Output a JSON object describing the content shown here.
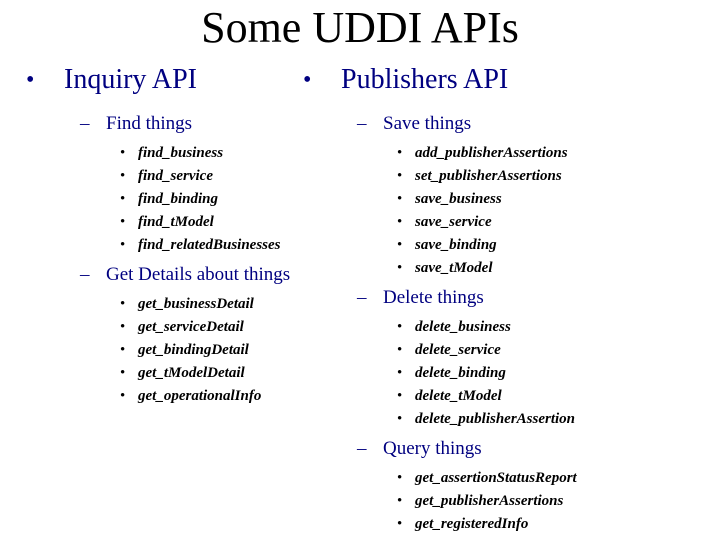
{
  "slide": {
    "title": "Some UDDI APIs",
    "bullet_glyph": "•",
    "dash_glyph": "–",
    "columns": [
      {
        "heading": "Inquiry API",
        "groups": [
          {
            "label": "Find things",
            "items": [
              "find_business",
              "find_service",
              "find_binding",
              "find_tModel",
              "find_relatedBusinesses"
            ]
          },
          {
            "label": "Get Details about things",
            "items": [
              "get_businessDetail",
              "get_serviceDetail",
              "get_bindingDetail",
              "get_tModelDetail",
              "get_operationalInfo"
            ]
          }
        ]
      },
      {
        "heading": "Publishers API",
        "groups": [
          {
            "label": "Save things",
            "items": [
              "add_publisherAssertions",
              "set_publisherAssertions",
              "save_business",
              "save_service",
              "save_binding",
              "save_tModel"
            ]
          },
          {
            "label": "Delete things",
            "items": [
              "delete_business",
              "delete_service",
              "delete_binding",
              "delete_tModel",
              "delete_publisherAssertion"
            ]
          },
          {
            "label": "Query things",
            "items": [
              "get_assertionStatusReport",
              "get_publisherAssertions",
              "get_registeredInfo"
            ]
          }
        ]
      }
    ]
  },
  "colors": {
    "heading": "#000080",
    "items": "#000000",
    "background": "#ffffff"
  }
}
